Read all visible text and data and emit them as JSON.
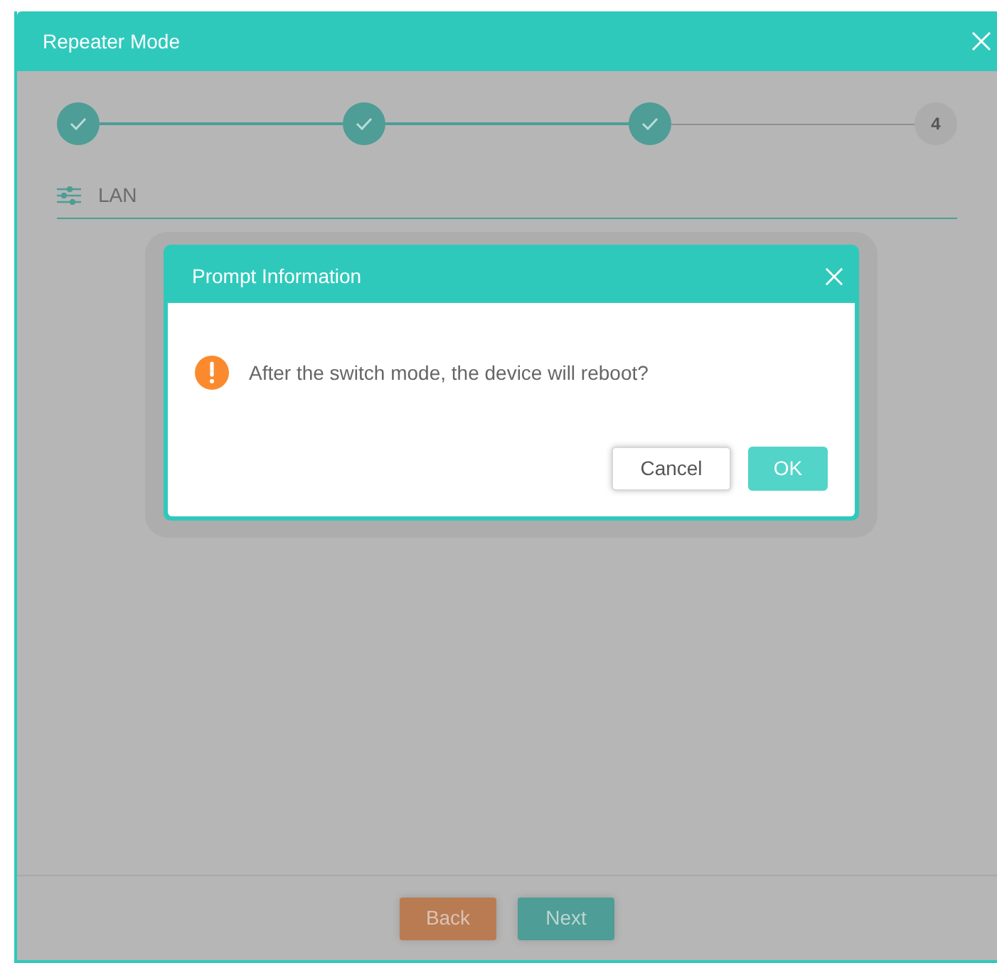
{
  "window": {
    "title": "Repeater Mode"
  },
  "steps": [
    {
      "done": true
    },
    {
      "done": true
    },
    {
      "done": true
    },
    {
      "done": false,
      "label": "4"
    }
  ],
  "section": {
    "title": "LAN"
  },
  "dialog": {
    "title": "Prompt Information",
    "message": "After the switch mode, the device will reboot?",
    "buttons": [
      {
        "label": "Cancel",
        "kind": "secondary"
      },
      {
        "label": "OK",
        "kind": "primary"
      }
    ]
  },
  "footer": {
    "buttons": [
      {
        "label": "Back",
        "kind": "back"
      },
      {
        "label": "Next",
        "kind": "next"
      }
    ]
  }
}
